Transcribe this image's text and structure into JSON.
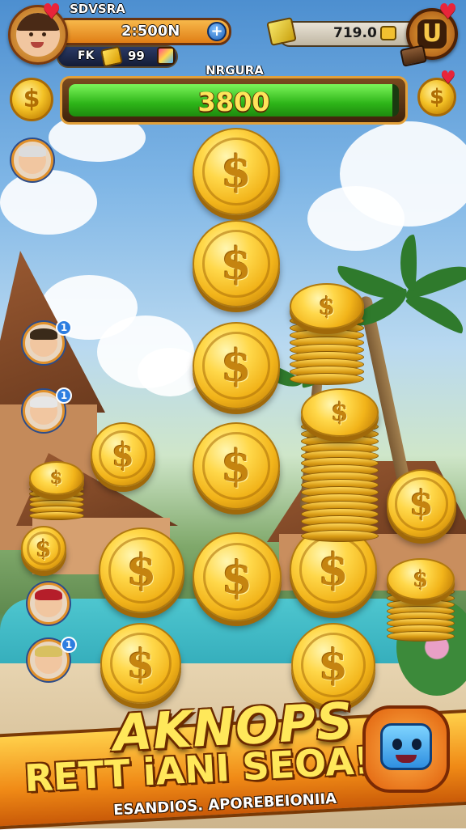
{
  "player": {
    "name": "SDVSRA",
    "coins": "2:500N",
    "tag": "FK",
    "gems": "99",
    "avatar_icon": "player-avatar",
    "heart_icon": "heart-icon"
  },
  "currency": {
    "amount": "719.0"
  },
  "progress": {
    "title": "NRGURA",
    "value": "3800",
    "fill_fraction": 0.98
  },
  "banner": {
    "title": "AKNOPS",
    "subtitle": "RETT iANI SEOA!",
    "caption": "ESANDIOS. APOREBEIONIIA"
  },
  "characters": [
    {
      "name": "character-grandma",
      "badge": ""
    },
    {
      "name": "character-boy",
      "badge": "1"
    },
    {
      "name": "character-granny",
      "badge": "1"
    },
    {
      "name": "character-red-hat",
      "badge": ""
    },
    {
      "name": "character-cap",
      "badge": "1"
    }
  ],
  "colors": {
    "accent_orange": "#f08a16",
    "progress_green": "#2db418",
    "coin_gold": "#f2b41a",
    "badge_blue": "#2e7ee0"
  }
}
